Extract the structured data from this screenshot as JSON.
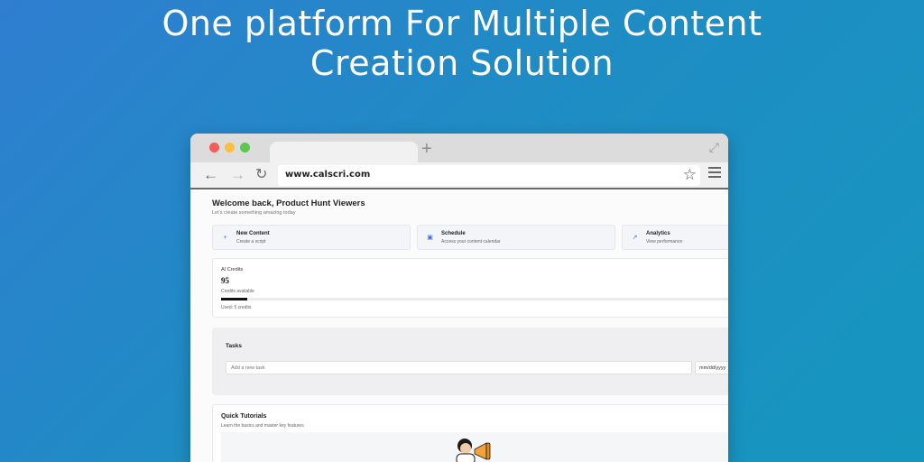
{
  "headline": {
    "line1": "One platform For Multiple Content",
    "line2": "Creation Solution"
  },
  "browser": {
    "address": "www.calscri.com",
    "icons": {
      "back": "arrow-left-icon",
      "forward": "arrow-right-icon",
      "reload": "reload-icon",
      "bookmark": "star-icon",
      "menu": "hamburger-menu-icon",
      "new_tab": "plus-icon",
      "expand": "expand-icon"
    }
  },
  "dashboard": {
    "welcome": "Welcome back, Product Hunt Viewers",
    "subtitle": "Let's create something amazing today",
    "cards": [
      {
        "title": "New Content",
        "subtitle": "Create a script",
        "icon": "plus-icon"
      },
      {
        "title": "Schedule",
        "subtitle": "Access your content calendar",
        "icon": "calendar-icon"
      },
      {
        "title": "Analytics",
        "subtitle": "View performance",
        "icon": "trend-up-icon"
      }
    ],
    "credits": {
      "label": "AI Credits",
      "value": "95",
      "available_label": "Credits available",
      "used": "Used: 5 credits",
      "usage_fraction": 0.05
    },
    "tasks": {
      "title": "Tasks",
      "input_placeholder": "Add a new task",
      "date_placeholder": "mm/dd/yyyy"
    },
    "tutorials": {
      "title": "Quick Tutorials",
      "subtitle": "Learn the basics and master key features"
    }
  },
  "colors": {
    "background": "#2f7ed0",
    "accent": "#3a6fd8"
  }
}
